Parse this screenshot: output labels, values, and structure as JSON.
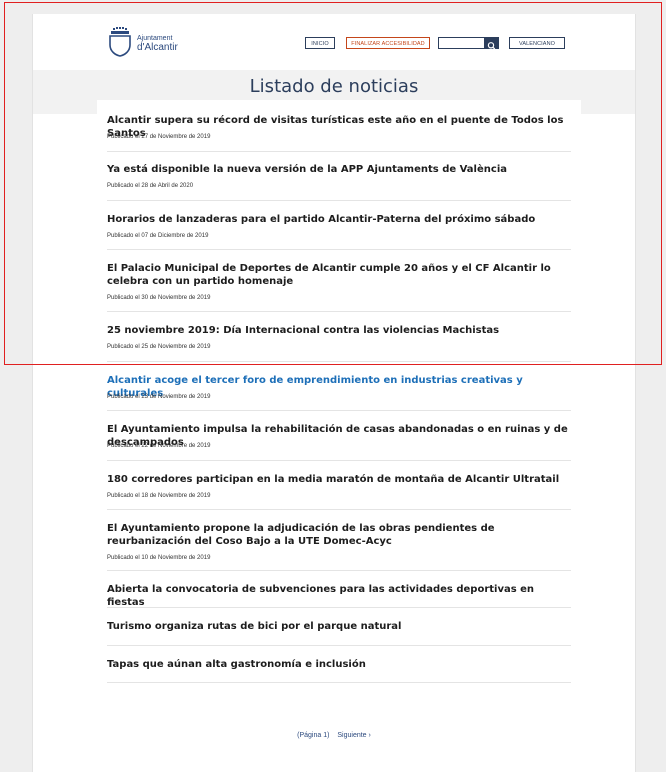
{
  "header": {
    "logo_top": "Ajuntament",
    "logo_bottom": "d'Alcantir",
    "inicio_label": "INICIO",
    "accesibilidad_label": "FINALIZAR ACCESIBILIDAD",
    "search_placeholder": "",
    "valenciano_label": "VALENCIANO"
  },
  "page_title": "Listado de noticias",
  "news": [
    {
      "title": "Alcantir supera su récord de visitas turísticas este año en el puente de Todos los Santos",
      "date": "Publicado el 27 de Noviembre de 2019"
    },
    {
      "title": "Ya está disponible la nueva versión de la APP Ajuntaments de València",
      "date": "Publicado el 28 de Abril de 2020"
    },
    {
      "title": "Horarios de lanzaderas para el partido Alcantir-Paterna del próximo sábado",
      "date": "Publicado el 07 de Diciembre de 2019"
    },
    {
      "title": "El Palacio Municipal de Deportes de Alcantir cumple 20 años y el CF Alcantir lo celebra con un partido homenaje",
      "date": "Publicado el 30 de Noviembre de 2019"
    },
    {
      "title": "25 noviembre 2019: Día Internacional contra las violencias Machistas",
      "date": "Publicado el 25 de Noviembre de 2019"
    },
    {
      "title": "Alcantir acoge el tercer foro de emprendimiento en industrias creativas y culturales",
      "date": "Publicado el 23 de Noviembre de 2019"
    },
    {
      "title": "El Ayuntamiento impulsa la rehabilitación de casas abandonadas o en ruinas y de descampados",
      "date": "Publicado el 22 de Noviembre de 2019"
    },
    {
      "title": "180 corredores participan en la media maratón de montaña de Alcantir Ultratail",
      "date": "Publicado el 18 de Noviembre de 2019"
    },
    {
      "title": "El Ayuntamiento propone la adjudicación de las obras pendientes de reurbanización del Coso Bajo a la UTE Domec-Acyc",
      "date": "Publicado el 10 de Noviembre de 2019"
    },
    {
      "title": "Abierta la convocatoria de subvenciones para las actividades deportivas en fiestas",
      "date": ""
    },
    {
      "title": "Turismo organiza rutas de bici por el parque natural",
      "date": ""
    },
    {
      "title": "Tapas que aúnan alta gastronomía e inclusión",
      "date": ""
    }
  ],
  "pager": {
    "page_label": "(Página 1)",
    "next_label": "Siguiente ›"
  },
  "colors": {
    "accent": "#2c3e5c",
    "link": "#1d6fb8",
    "highlight": "#e02020"
  }
}
